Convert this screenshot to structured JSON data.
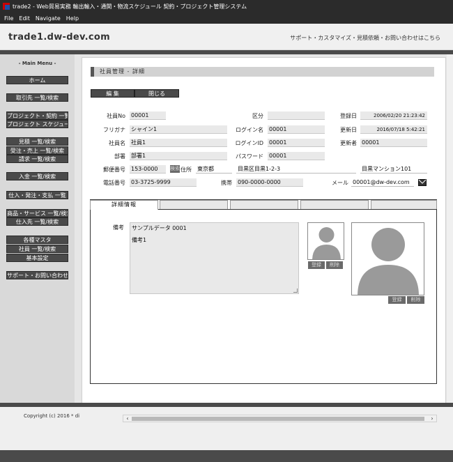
{
  "window": {
    "title": "trade2 - Web貿易実務 輸出輸入・通関・物流スケジュール 契約・プロジェクト管理システム"
  },
  "menubar": [
    "File",
    "Edit",
    "Navigate",
    "Help"
  ],
  "header": {
    "site_title": "trade1.dw-dev.com",
    "links": "サポート・カスタマイズ・見積依頼・お問い合わせはこちら"
  },
  "sidebar": {
    "label": "- Main Menu -",
    "items": [
      "ホーム",
      "取引先 一覧/検索",
      "プロジェクト・契約 一覧",
      "プロジェクト スケジュール",
      "見積 一覧/検索",
      "受注・売上 一覧/検索",
      "請求 一覧/検索",
      "入金 一覧/検索",
      "仕入・発注・支払 一覧",
      "商品・サービス 一覧/検索",
      "仕入先 一覧/検索",
      "各種マスタ",
      "社員 一覧/検索",
      "基本設定",
      "サポート・お問い合わせ"
    ]
  },
  "section": {
    "title": "社員管理 - 詳細"
  },
  "actions": {
    "edit": "編 集",
    "close": "閉じる"
  },
  "form": {
    "employee_no": {
      "label": "社員No",
      "value": "00001"
    },
    "category": {
      "label": "区分",
      "value": ""
    },
    "registered_at": {
      "label": "登録日",
      "value": "2006/02/20 21:23:42"
    },
    "furigana": {
      "label": "フリガナ",
      "value": "シャイン1"
    },
    "login_name": {
      "label": "ログイン名",
      "value": "00001"
    },
    "updated_at": {
      "label": "更新日",
      "value": "2016/07/18 5:42:21"
    },
    "name": {
      "label": "社員名",
      "value": "社員1"
    },
    "login_id": {
      "label": "ログインID",
      "value": "00001"
    },
    "updated_by": {
      "label": "更新者",
      "value": "00001"
    },
    "department": {
      "label": "部署",
      "value": "部署1"
    },
    "password": {
      "label": "パスワード",
      "value": "00001"
    },
    "postal": {
      "label": "郵便番号",
      "value": "153-0000",
      "search_btn": "検索"
    },
    "address": {
      "label": "住所",
      "pref": "東京都",
      "city": "目黒区目黒1-2-3",
      "building": "目黒マンション101"
    },
    "phone": {
      "label": "電話番号",
      "value": "03-3725-9999"
    },
    "mobile": {
      "label": "携帯",
      "value": "090-0000-0000"
    },
    "email": {
      "label": "メール",
      "value": "00001@dw-dev.com"
    }
  },
  "tabs": {
    "active": "詳細情報"
  },
  "detail": {
    "note_label": "備考",
    "note_title": "サンプルデータ 0001",
    "note_body": "備考1",
    "photo_small": {
      "register": "登録",
      "delete": "削除"
    },
    "photo_large": {
      "register": "登録",
      "delete": "削除"
    }
  },
  "footer": {
    "copyright": "Copyright (c) 2016 * di"
  }
}
